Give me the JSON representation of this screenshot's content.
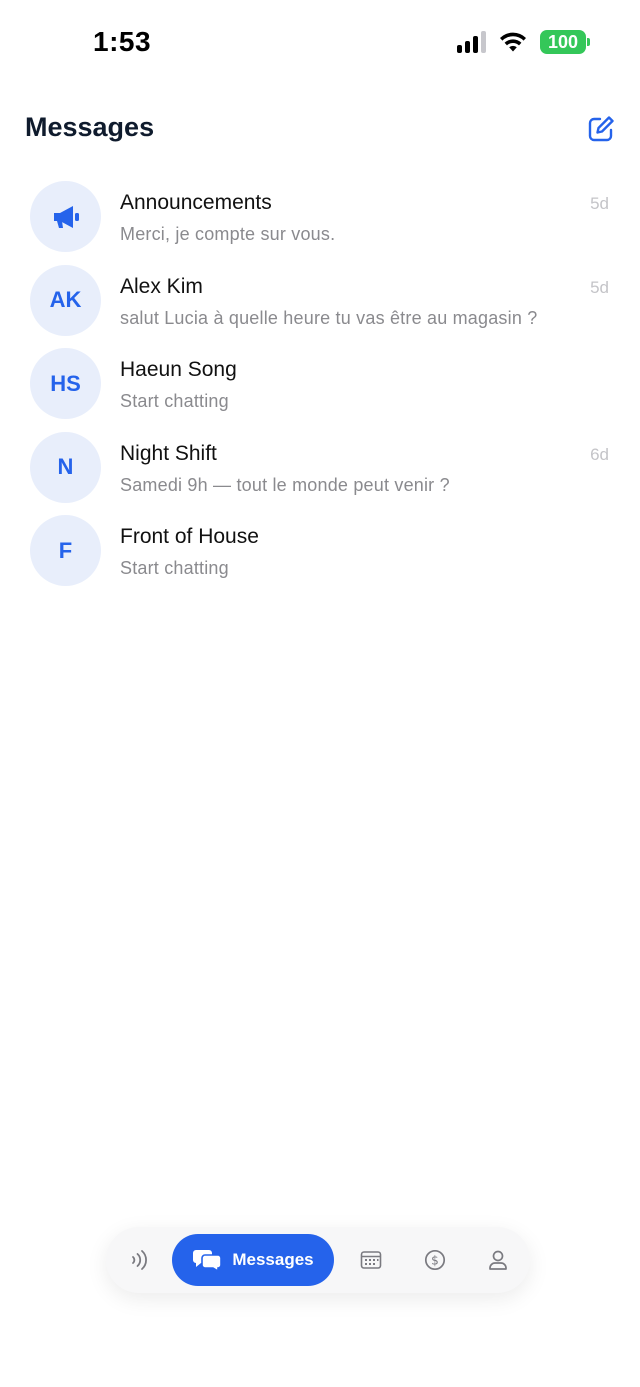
{
  "status_bar": {
    "time": "1:53",
    "battery": "100",
    "icons": [
      "signal-icon",
      "wifi-icon",
      "battery-icon"
    ]
  },
  "header": {
    "title": "Messages",
    "compose_icon": "compose-icon"
  },
  "conversations": [
    {
      "initials": "",
      "icon": "megaphone-icon",
      "name": "Announcements",
      "preview": "Merci, je compte sur vous.",
      "time": "5d"
    },
    {
      "initials": "AK",
      "name": "Alex Kim",
      "preview": "salut Lucia à quelle heure tu vas être au magasin ?",
      "time": "5d"
    },
    {
      "initials": "HS",
      "name": "Haeun Song",
      "preview": "Start chatting",
      "time": ""
    },
    {
      "initials": "N",
      "name": "Night Shift",
      "preview": "Samedi 9h — tout le monde peut venir ?",
      "time": "6d"
    },
    {
      "initials": "F",
      "name": "Front of House",
      "preview": "Start chatting",
      "time": ""
    }
  ],
  "tab_bar": {
    "active": "messages",
    "messages_label": "Messages",
    "icons": [
      "nfc-icon",
      "chat-bubbles-icon",
      "calendar-icon",
      "dollar-icon",
      "person-icon"
    ]
  },
  "colors": {
    "accent": "#2563eb",
    "avatar_bg": "#e8eefb",
    "battery": "#34c759",
    "muted_text": "#8a8a8e"
  }
}
